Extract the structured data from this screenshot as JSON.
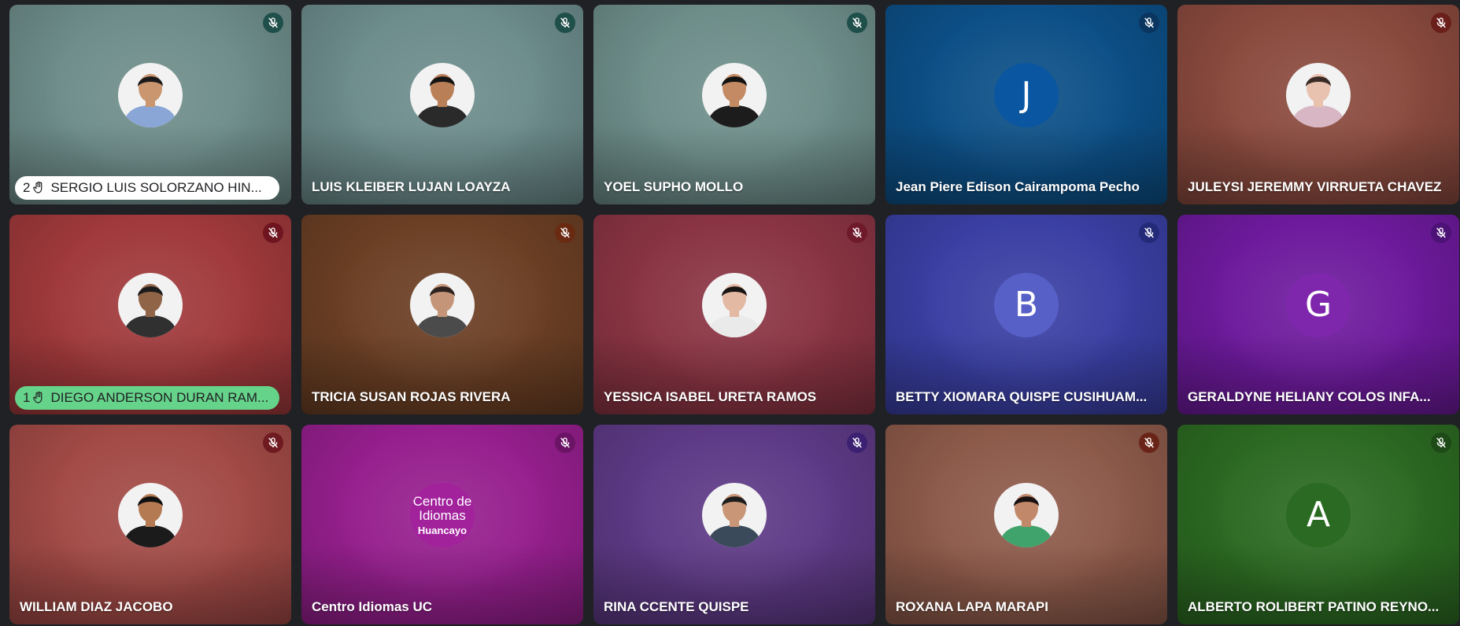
{
  "participants": [
    {
      "name": "SERGIO LUIS SOLORZANO HIN...",
      "bg": "#6e8d8a",
      "mic": "#1f4f4a",
      "avatar": "photo",
      "skin": "#c9966f",
      "hair": "#1a1a1a",
      "shirt": "#8aa6d6",
      "hand": true,
      "hand_order": "2",
      "pill": "#ffffff"
    },
    {
      "name": "LUIS KLEIBER LUJAN LOAYZA",
      "bg": "#6d8c8c",
      "mic": "#1f4f4a",
      "avatar": "photo",
      "skin": "#b97f57",
      "hair": "#151515",
      "shirt": "#2a2a2a",
      "hand": false
    },
    {
      "name": "YOEL SUPHO MOLLO",
      "bg": "#6e8e8a",
      "mic": "#1f4f4a",
      "avatar": "photo",
      "skin": "#c48a63",
      "hair": "#121212",
      "shirt": "#1c1c1c",
      "hand": false
    },
    {
      "name": "Jean Piere Edison Cairampoma Pecho",
      "bg": "#0c4f86",
      "mic": "#0a3560",
      "avatar": "letter",
      "letter": "J",
      "circle": "#0b56a0",
      "hand": false
    },
    {
      "name": "JULEYSI JEREMMY VIRRUETA CHAVEZ",
      "bg": "#8a4a3e",
      "mic": "#6a1f1a",
      "avatar": "photo",
      "skin": "#e8c2ae",
      "hair": "#3a2b26",
      "shirt": "#d9b6c4",
      "hand": false
    },
    {
      "name": "DIEGO ANDERSON DURAN RAM...",
      "bg": "#a0393b",
      "mic": "#6f1520",
      "avatar": "photo",
      "skin": "#8f6447",
      "hair": "#1b1b1b",
      "shirt": "#303030",
      "hand": true,
      "hand_order": "1",
      "pill": "#66d38a"
    },
    {
      "name": "TRICIA SUSAN ROJAS RIVERA",
      "bg": "#6b3f24",
      "mic": "#6a2a12",
      "avatar": "photo",
      "skin": "#c49579",
      "hair": "#2e2320",
      "shirt": "#4b4b4b",
      "hand": false
    },
    {
      "name": "YESSICA ISABEL URETA RAMOS",
      "bg": "#8a3443",
      "mic": "#6f1a2a",
      "avatar": "photo",
      "skin": "#e3b9a4",
      "hair": "#191514",
      "shirt": "#eaeaea",
      "hand": false
    },
    {
      "name": "BETTY XIOMARA QUISPE CUSIHUAM...",
      "bg": "#3a3fa3",
      "mic": "#232a78",
      "avatar": "letter",
      "letter": "B",
      "circle": "#5660c6",
      "hand": false
    },
    {
      "name": "GERALDYNE HELIANY COLOS INFA...",
      "bg": "#6d1a9c",
      "mic": "#4d1276",
      "avatar": "letter",
      "letter": "G",
      "circle": "#7e27ad",
      "hand": false
    },
    {
      "name": "WILLIAM DIAZ JACOBO",
      "bg": "#a24a46",
      "mic": "#6f1a20",
      "avatar": "photo",
      "skin": "#b47a52",
      "hair": "#101010",
      "shirt": "#1b1b1b",
      "hand": false
    },
    {
      "name": "Centro Idiomas UC",
      "bg": "#961f8e",
      "mic": "#6b1465",
      "avatar": "logo",
      "circle": "#a2229c",
      "logo_line1": "Centro de",
      "logo_line2": "Idiomas",
      "logo_sub": "Huancayo",
      "hand": false
    },
    {
      "name": "RINA CCENTE QUISPE",
      "bg": "#5e3a86",
      "mic": "#3c2173",
      "avatar": "photo",
      "skin": "#c99678",
      "hair": "#1d1d1d",
      "shirt": "#3a4a5a",
      "hand": false
    },
    {
      "name": "ROXANA LAPA MARAPI",
      "bg": "#8d5a4a",
      "mic": "#6a2417",
      "avatar": "photo",
      "skin": "#c2886a",
      "hair": "#1a1212",
      "shirt": "#3fa36b",
      "hand": false
    },
    {
      "name": "ALBERTO ROLIBERT PATINO REYNO...",
      "bg": "#2c6a22",
      "mic": "#1d4a17",
      "avatar": "letter",
      "letter": "A",
      "circle": "#2a6a22",
      "hand": false
    }
  ]
}
